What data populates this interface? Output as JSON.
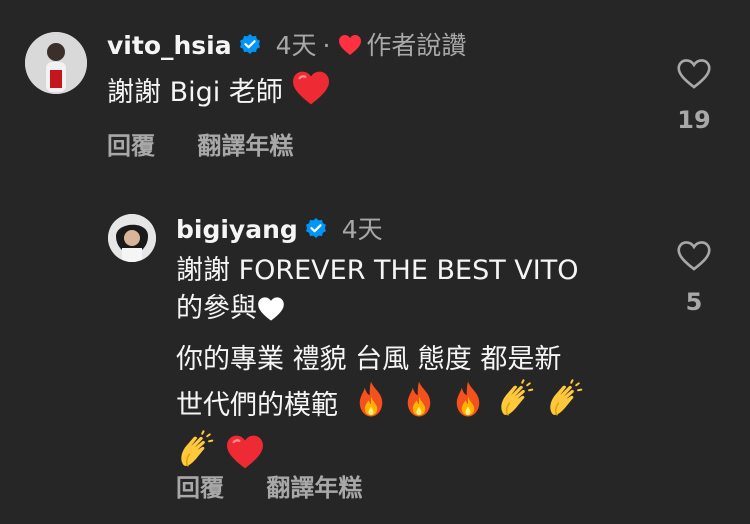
{
  "comments": [
    {
      "username": "vito_hsia",
      "time": "4天",
      "separator": "·",
      "author_liked_label": "作者說讚",
      "text_lines": [
        "謝謝 Bigi 老師"
      ],
      "reply_label": "回覆",
      "translate_label": "翻譯年糕",
      "like_count": "19",
      "icons": [
        "avatar",
        "verified-badge-icon",
        "red-heart-icon",
        "red-heart-emoji",
        "heart-outline-icon"
      ]
    },
    {
      "username": "bigiyang",
      "time": "4天",
      "text_lines": [
        "謝謝 FOREVER THE BEST VITO",
        "的參與",
        "你的專業 禮貌 台風 態度 都是新",
        "世代們的模範"
      ],
      "reply_label": "回覆",
      "translate_label": "翻譯年糕",
      "like_count": "5",
      "icons": [
        "avatar",
        "verified-badge-icon",
        "white-heart-emoji",
        "fire-emoji",
        "clapping-hands-emoji",
        "red-heart-emoji",
        "heart-outline-icon"
      ]
    }
  ],
  "colors": {
    "background": "#262626",
    "primary_text": "#f5f5f5",
    "secondary_text": "#a8a8a8",
    "verified_blue": "#0095f6",
    "heart_red": "#ff3040"
  }
}
